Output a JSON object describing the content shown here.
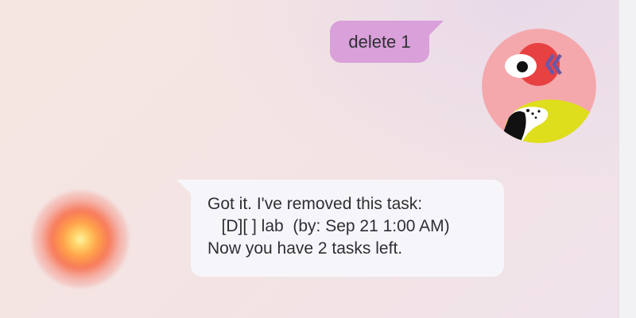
{
  "messages": [
    {
      "sender": "user",
      "text": "delete 1",
      "avatar": "user-avatar-illustration",
      "bubble_color": "#d9a0da"
    },
    {
      "sender": "bot",
      "lines": [
        "Got it. I've removed this task:",
        "   [D][ ] lab  (by: Sep 21 1:00 AM)",
        "Now you have 2 tasks left."
      ],
      "avatar": "bot-avatar-glow",
      "bubble_color": "#f6f5fa"
    }
  ],
  "colors": {
    "background": "#f4e5e4",
    "text": "#2f2f33",
    "user_avatar_bg": "#f4a8ab",
    "user_avatar_accent": "#e84142",
    "user_avatar_body": "#dede1c",
    "user_avatar_chevrons": "#6b58a8"
  }
}
